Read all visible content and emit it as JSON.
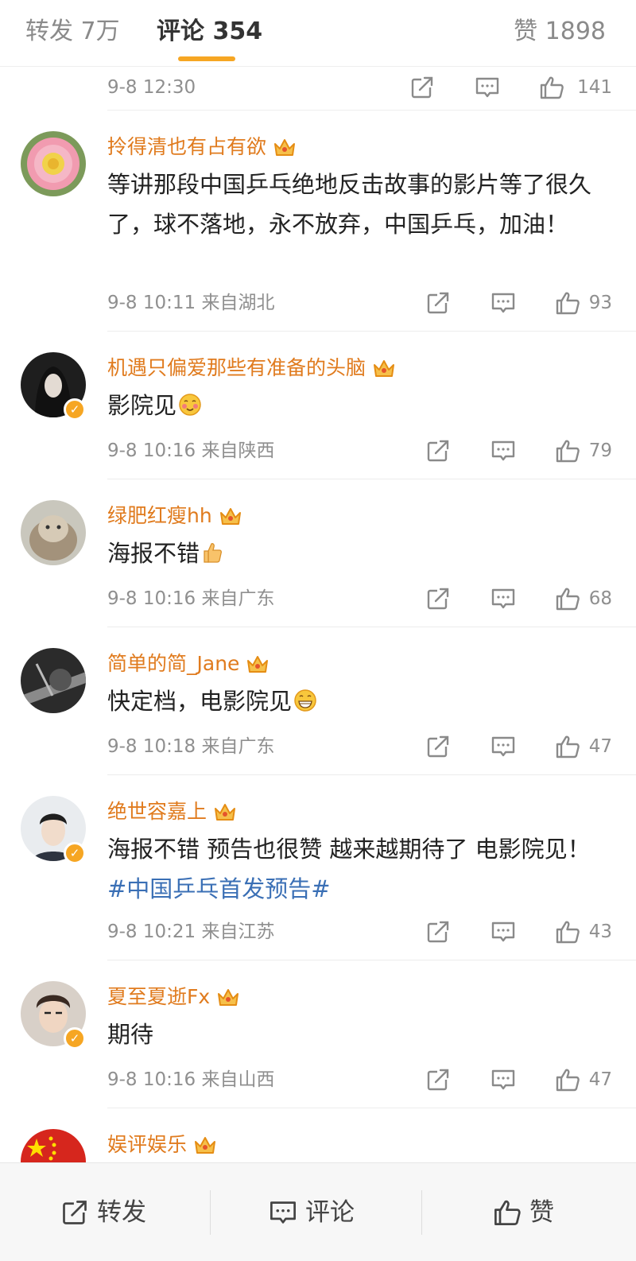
{
  "tabs": {
    "repost_label": "转发 7万",
    "comment_label": "评论 354",
    "like_label": "赞 1898"
  },
  "top_row": {
    "time": "9-8 12:30",
    "likes": "141"
  },
  "comments": [
    {
      "username": "拎得清也有占有欲",
      "text": "等讲那段中国乒乓绝地反击故事的影片等了很久了，球不落地，永不放弃，中国乒乓，加油！",
      "meta": "9-8 10:11 来自湖北",
      "likes": "93"
    },
    {
      "username": "机遇只偏爱那些有准备的头脑",
      "text": "影院见",
      "meta": "9-8 10:16 来自陕西",
      "likes": "79"
    },
    {
      "username": "绿肥红瘦hh",
      "text": "海报不错",
      "meta": "9-8 10:16 来自广东",
      "likes": "68"
    },
    {
      "username": "简单的简_Jane",
      "text": "快定档，电影院见",
      "meta": "9-8 10:18 来自广东",
      "likes": "47"
    },
    {
      "username": "绝世容嘉上",
      "text_main": "海报不错 预告也很赞 越来越期待了 电影院见！",
      "hashtag": "#中国乒乓首发预告#",
      "meta": "9-8 10:21 来自江苏",
      "likes": "43"
    },
    {
      "username": "夏至夏逝Fx",
      "text": "期待",
      "meta": "9-8 10:16 来自山西",
      "likes": "47"
    },
    {
      "username": "娱评娱乐"
    }
  ],
  "bottom_bar": {
    "repost": "转发",
    "comment": "评论",
    "like": "赞"
  },
  "icons": [
    "share-icon",
    "comment-icon",
    "thumbs-up-icon",
    "crown-badge-icon",
    "verified-badge-icon"
  ],
  "colors": {
    "accent": "#f6a623",
    "username": "#e07b1e",
    "hashtag": "#3a6fb5",
    "meta": "#8f8f8f"
  }
}
